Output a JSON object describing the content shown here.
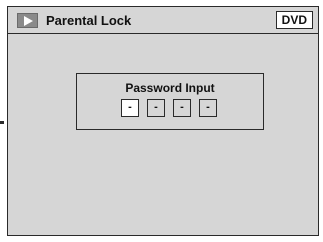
{
  "title_bar": {
    "title": "Parental Lock",
    "icon": "play-triangle-icon",
    "source_badge": "DVD"
  },
  "password_dialog": {
    "title": "Password Input",
    "digits": [
      "-",
      "-",
      "-",
      "-"
    ],
    "active_digit_index": 0
  },
  "colors": {
    "background": "#d6d6d6",
    "border": "#2a2a2a",
    "active_field": "#ffffff",
    "icon": "#8a8a8a"
  }
}
